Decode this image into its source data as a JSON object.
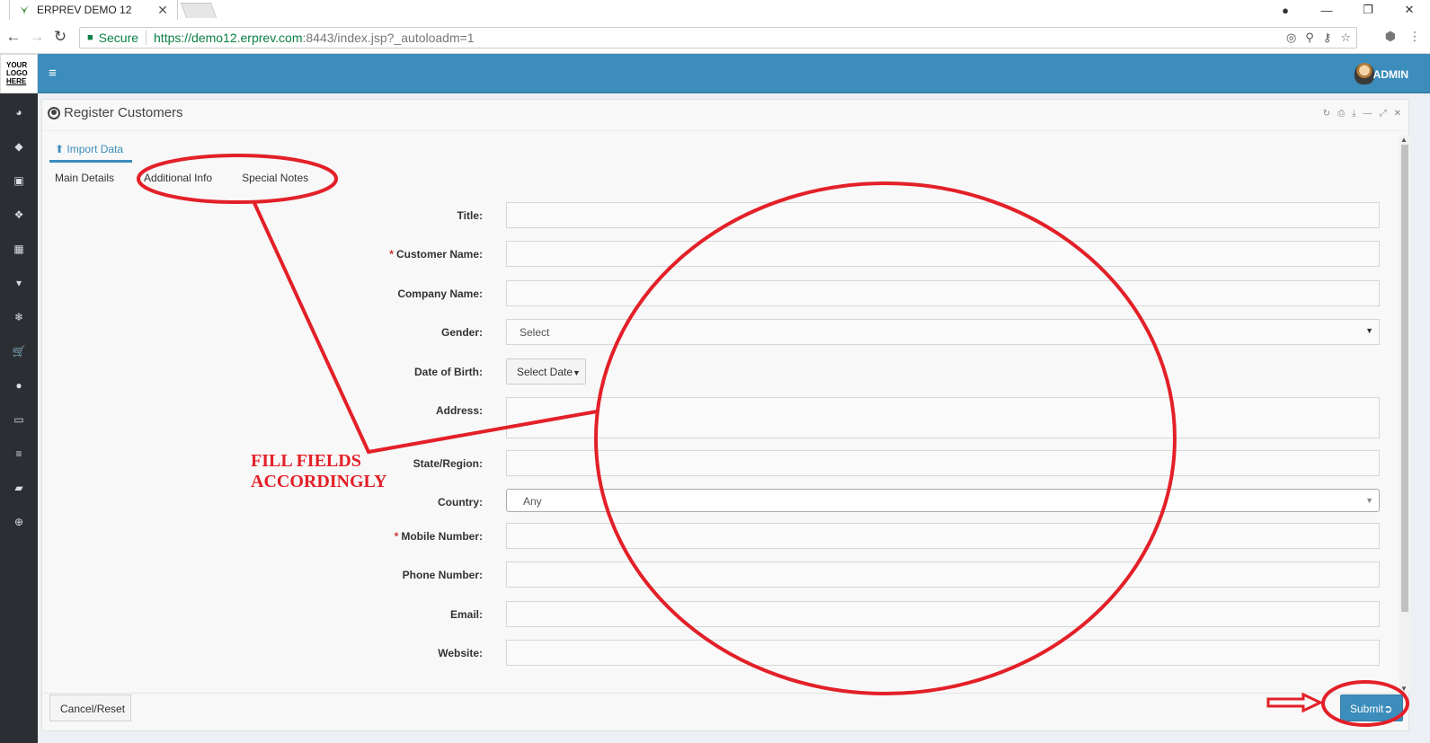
{
  "browser": {
    "tab_title": "ERPREV DEMO 12",
    "tab_close": "✕",
    "secure_label": "Secure",
    "url_main": "https://demo12.erprev.com",
    "url_rest": ":8443/index.jsp?_autoloadm=1"
  },
  "app": {
    "logo_lines": [
      "YOUR",
      "LOGO",
      "HERE"
    ],
    "user_name": "ADMIN",
    "sidebar_icons": [
      "dashboard-icon",
      "tag-icon",
      "money-icon",
      "cubes-icon",
      "building-icon",
      "archive-icon",
      "snowflake-icon",
      "cart-icon",
      "circle-icon",
      "desktop-icon",
      "database-icon",
      "book-icon",
      "support-icon"
    ]
  },
  "panel": {
    "title": "Register Customers",
    "import_label": "Import Data",
    "tabs": [
      {
        "label": "Main Details"
      },
      {
        "label": "Additional Info"
      },
      {
        "label": "Special Notes"
      }
    ]
  },
  "form": {
    "title_label": "Title:",
    "customer_name_label": "Customer Name:",
    "company_name_label": "Company Name:",
    "gender_label": "Gender:",
    "gender_value": "Select",
    "dob_label": "Date of Birth:",
    "dob_button": "Select Date",
    "address_label": "Address:",
    "state_label": "State/Region:",
    "country_label": "Country:",
    "country_value": "Any",
    "mobile_label": "Mobile Number:",
    "phone_label": "Phone Number:",
    "email_label": "Email:",
    "website_label": "Website:",
    "required_mark": "*"
  },
  "footer": {
    "cancel_label": "Cancel/Reset",
    "submit_label": "Submit"
  },
  "annotation": {
    "line1": "FILL FIELDS",
    "line2": "ACCORDINGLY",
    "color": "#e32028"
  }
}
